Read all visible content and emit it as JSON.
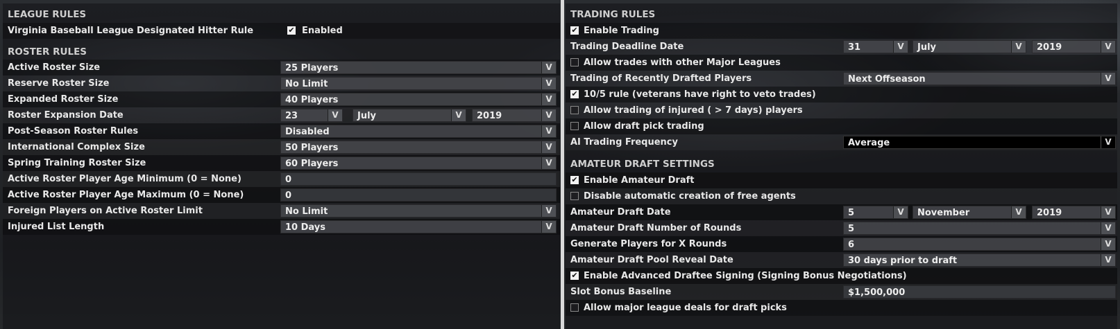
{
  "league_rules": {
    "title": "LEAGUE RULES",
    "dh_rule_label": "Virginia Baseball League Designated Hitter Rule",
    "dh_rule_value": "Enabled"
  },
  "roster_rules": {
    "title": "ROSTER RULES",
    "rows": [
      {
        "label": "Active Roster Size",
        "value": "25 Players"
      },
      {
        "label": "Reserve Roster Size",
        "value": "No Limit"
      },
      {
        "label": "Expanded Roster Size",
        "value": "40 Players"
      },
      {
        "label": "Roster Expansion Date",
        "day": "23",
        "month": "July",
        "year": "2019"
      },
      {
        "label": "Post-Season Roster Rules",
        "value": "Disabled"
      },
      {
        "label": "International Complex Size",
        "value": "50 Players"
      },
      {
        "label": "Spring Training Roster Size",
        "value": "60 Players"
      },
      {
        "label": "Active Roster Player Age Minimum (0 = None)",
        "value": "0"
      },
      {
        "label": "Active Roster Player Age Maximum (0 = None)",
        "value": "0"
      },
      {
        "label": "Foreign Players on Active Roster Limit",
        "value": "No Limit"
      },
      {
        "label": "Injured List Length",
        "value": "10 Days"
      }
    ]
  },
  "trading_rules": {
    "title": "TRADING RULES",
    "enable_trading": "Enable Trading",
    "deadline_label": "Trading Deadline Date",
    "deadline_day": "31",
    "deadline_month": "July",
    "deadline_year": "2019",
    "allow_other_leagues": "Allow trades with other Major Leagues",
    "recent_drafted_label": "Trading of Recently Drafted Players",
    "recent_drafted_value": "Next Offseason",
    "ten_five_rule": "10/5 rule (veterans have right to veto trades)",
    "allow_injured": "Allow trading of injured ( > 7 days) players",
    "allow_draft_pick": "Allow draft pick trading",
    "ai_frequency_label": "AI Trading Frequency",
    "ai_frequency_value": "Average"
  },
  "amateur_draft": {
    "title": "AMATEUR DRAFT SETTINGS",
    "enable_draft": "Enable Amateur Draft",
    "disable_auto_fa": "Disable automatic creation of free agents",
    "draft_date_label": "Amateur Draft Date",
    "draft_day": "5",
    "draft_month": "November",
    "draft_year": "2019",
    "rounds_label": "Amateur Draft Number of Rounds",
    "rounds_value": "5",
    "gen_players_label": "Generate Players for X Rounds",
    "gen_players_value": "6",
    "pool_reveal_label": "Amateur Draft Pool Reveal Date",
    "pool_reveal_value": "30 days prior to draft",
    "advanced_signing": "Enable Advanced Draftee Signing (Signing Bonus Negotiations)",
    "slot_bonus_label": "Slot Bonus Baseline",
    "slot_bonus_value": "$1,500,000",
    "major_league_deals": "Allow major league deals for draft picks"
  },
  "icons": {
    "check": "✔",
    "dropdown": "V"
  }
}
